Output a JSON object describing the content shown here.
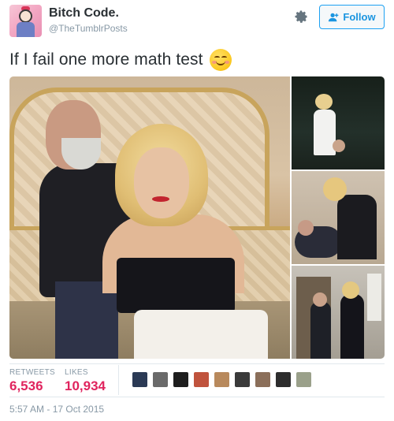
{
  "user": {
    "display_name": "Bitch Code.",
    "handle": "@TheTumblrPosts",
    "avatar_icon": "profile-avatar"
  },
  "actions": {
    "settings_icon": "gear-icon",
    "follow_label": "Follow",
    "follow_icon": "add-user-icon"
  },
  "tweet": {
    "text": "If I fail one more math test",
    "emoji_icon": "smiling-blushing-face-icon"
  },
  "media": {
    "photo_count": 4
  },
  "stats": {
    "retweets_label": "RETWEETS",
    "retweets_value": "6,536",
    "likes_label": "LIKES",
    "likes_value": "10,934",
    "liker_avatars": [
      {
        "color": "#2b3a55"
      },
      {
        "color": "#6a6a6a"
      },
      {
        "color": "#1e1e1e"
      },
      {
        "color": "#c0533d"
      },
      {
        "color": "#b8895c"
      },
      {
        "color": "#3a3a3a"
      },
      {
        "color": "#8b6f5a"
      },
      {
        "color": "#2d2d2d"
      },
      {
        "color": "#9aa08a"
      }
    ]
  },
  "timestamp": "5:57 AM - 17 Oct 2015",
  "colors": {
    "accent": "#1da1f2",
    "likes_number": "#e0245e",
    "muted": "#8899a6"
  }
}
